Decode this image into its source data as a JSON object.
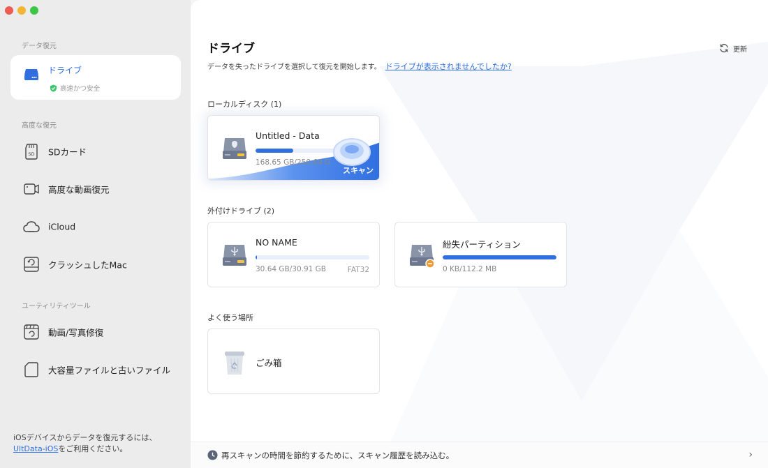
{
  "window": {
    "controls": [
      "close",
      "minimize",
      "zoom"
    ]
  },
  "sidebar": {
    "section_recovery": "データ復元",
    "drive_item": {
      "label": "ドライブ",
      "sub": "高速かつ安全"
    },
    "section_advanced": "高度な復元",
    "advanced_items": [
      {
        "label": "SDカード",
        "icon": "sd-card-icon"
      },
      {
        "label": "高度な動画復元",
        "icon": "video-icon"
      },
      {
        "label": "iCloud",
        "icon": "cloud-icon"
      },
      {
        "label": "クラッシュしたMac",
        "icon": "mac-crash-icon"
      }
    ],
    "section_utility": "ユーティリティツール",
    "utility_items": [
      {
        "label": "動画/写真修復",
        "icon": "repair-icon"
      },
      {
        "label": "大容量ファイルと古いファイル",
        "icon": "file-icon"
      }
    ],
    "bottom_line1": "iOSデバイスからデータを復元するには、",
    "bottom_link": "UltData-iOS",
    "bottom_line2": "をご利用ください。"
  },
  "main": {
    "title": "ドライブ",
    "subtitle": "データを失ったドライブを選択して復元を開始します。",
    "subtitle_link": "ドライブが表示されませんでしたか?",
    "refresh_label": "更新",
    "local_header": "ローカルディスク (1)",
    "local_disks": [
      {
        "name": "Untitled - Data",
        "size": "168.65 GB/250.69 G",
        "usage": 0.33,
        "scan_label": "スキャン"
      }
    ],
    "external_header": "外付けドライブ (2)",
    "external_drives": [
      {
        "name": "NO NAME",
        "size": "30.64 GB/30.91 GB",
        "fs": "FAT32",
        "usage": 0.01
      },
      {
        "name": "紛失パーティション",
        "size": "0 KB/112.2 MB",
        "usage": 1.0
      }
    ],
    "common_header": "よく使う場所",
    "common_places": [
      {
        "name": "ごみ箱"
      }
    ]
  },
  "footer": {
    "text": "再スキャンの時間を節約するために、スキャン履歴を読み込む。"
  },
  "colors": {
    "accent": "#2f6fe0",
    "sidebar_bg": "#ececec",
    "close": "#ee5b53",
    "minimize": "#f4b632",
    "zoom": "#3cc645"
  }
}
